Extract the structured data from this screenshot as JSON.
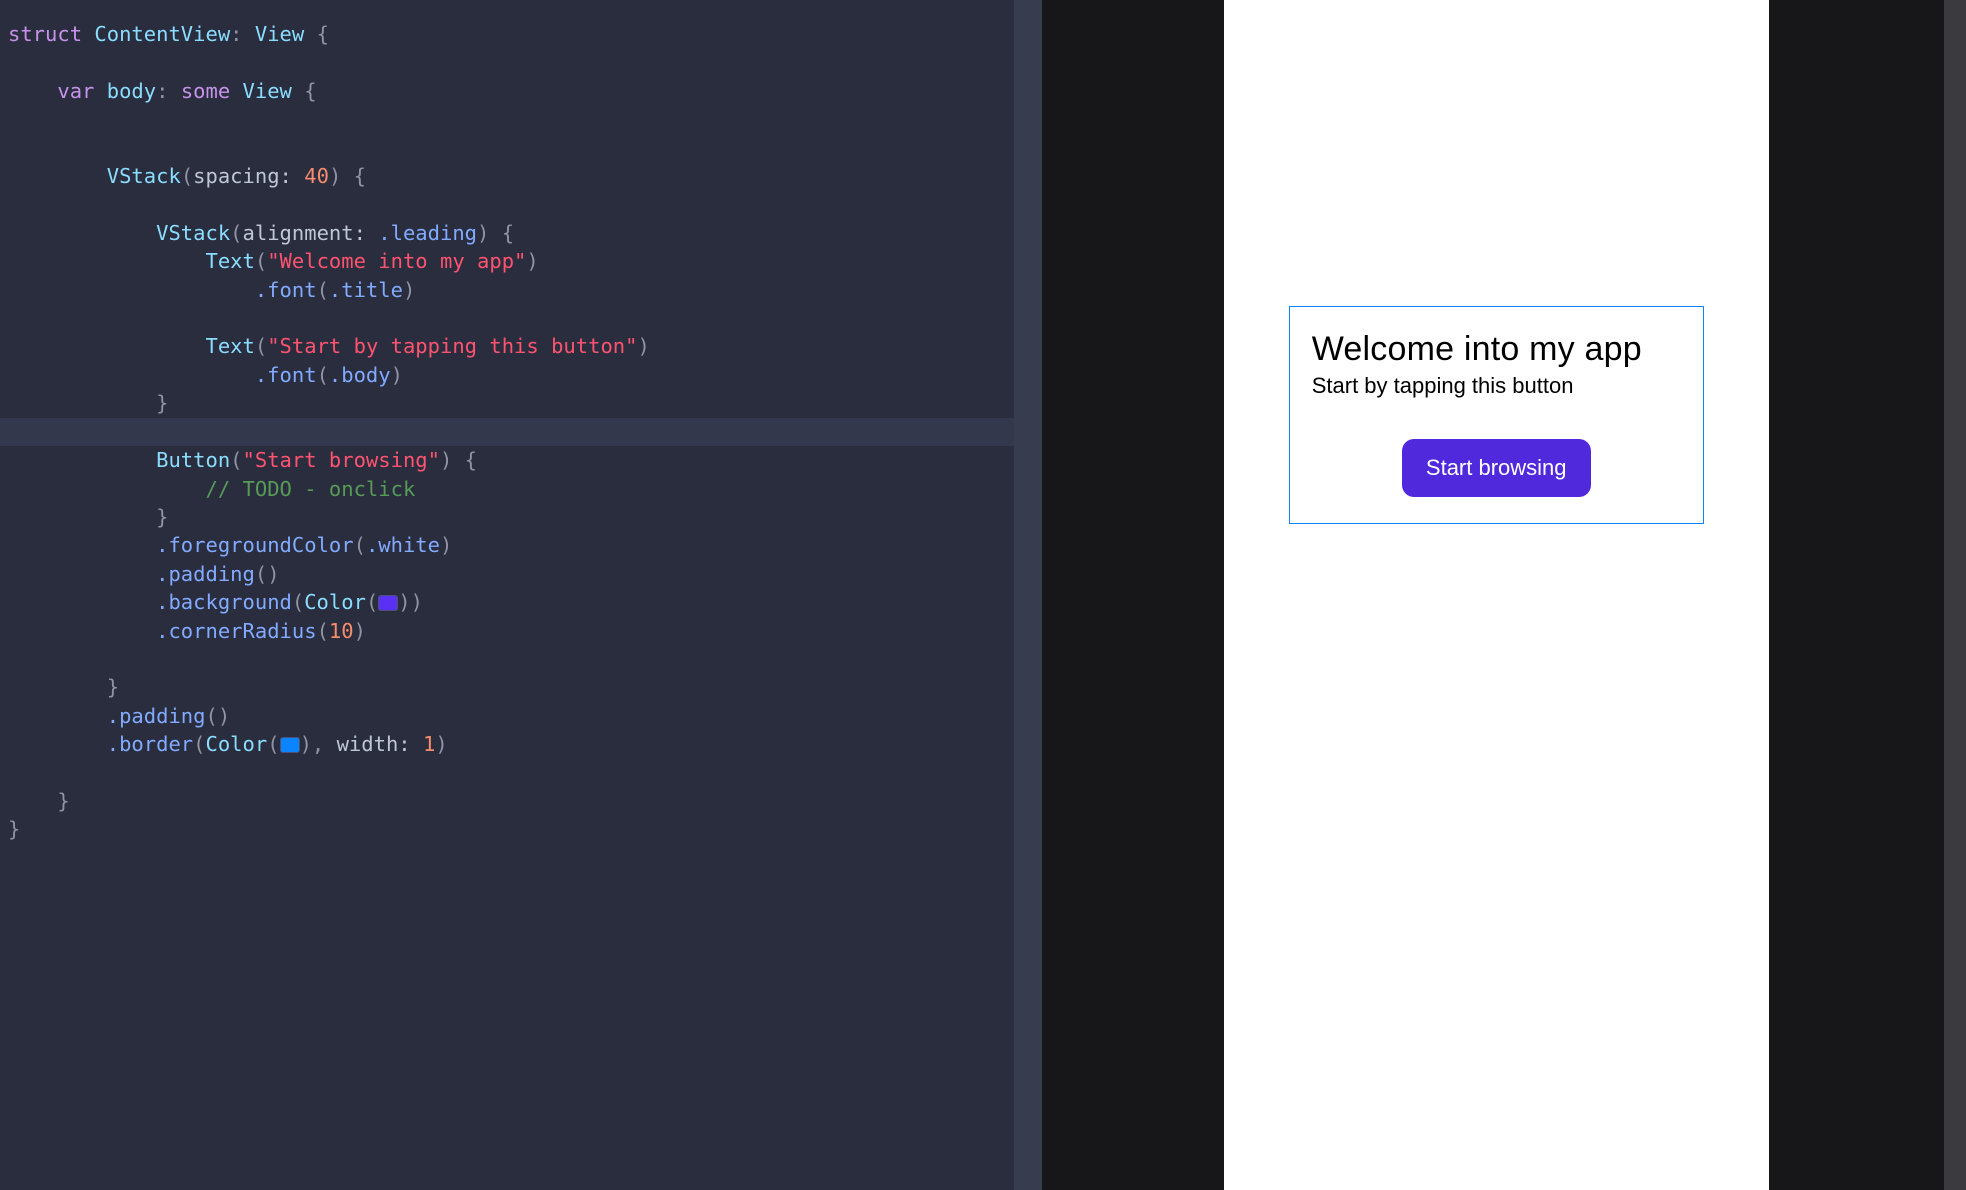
{
  "code": {
    "struct_keyword": "struct",
    "struct_name": "ContentView",
    "conform_type": "View",
    "var_keyword": "var",
    "body_prop": "body",
    "some_keyword": "some",
    "return_type": "View",
    "vstack_outer": "VStack",
    "spacing_label": "spacing:",
    "spacing_value": "40",
    "vstack_inner": "VStack",
    "alignment_label": "alignment:",
    "alignment_value": ".leading",
    "text1_call": "Text",
    "text1_string": "\"Welcome into my app\"",
    "font_mod": ".font",
    "font1_arg": ".title",
    "text2_call": "Text",
    "text2_string": "\"Start by tapping this button\"",
    "font2_arg": ".body",
    "button_call": "Button",
    "button_string": "\"Start browsing\"",
    "todo_comment": "// TODO - onclick",
    "fgcolor_mod": ".foregroundColor",
    "fgcolor_arg": ".white",
    "padding_mod": ".padding",
    "background_mod": ".background",
    "color_call": "Color",
    "corner_mod": ".cornerRadius",
    "corner_arg": "10",
    "padding2_mod": ".padding",
    "border_mod": ".border",
    "border_width_label": "width:",
    "border_width_val": "1"
  },
  "preview": {
    "title": "Welcome into my app",
    "subtitle": "Start by tapping this button",
    "button_label": "Start browsing"
  },
  "colors": {
    "button_bg": "#4f29db",
    "border": "#0a84ff"
  }
}
